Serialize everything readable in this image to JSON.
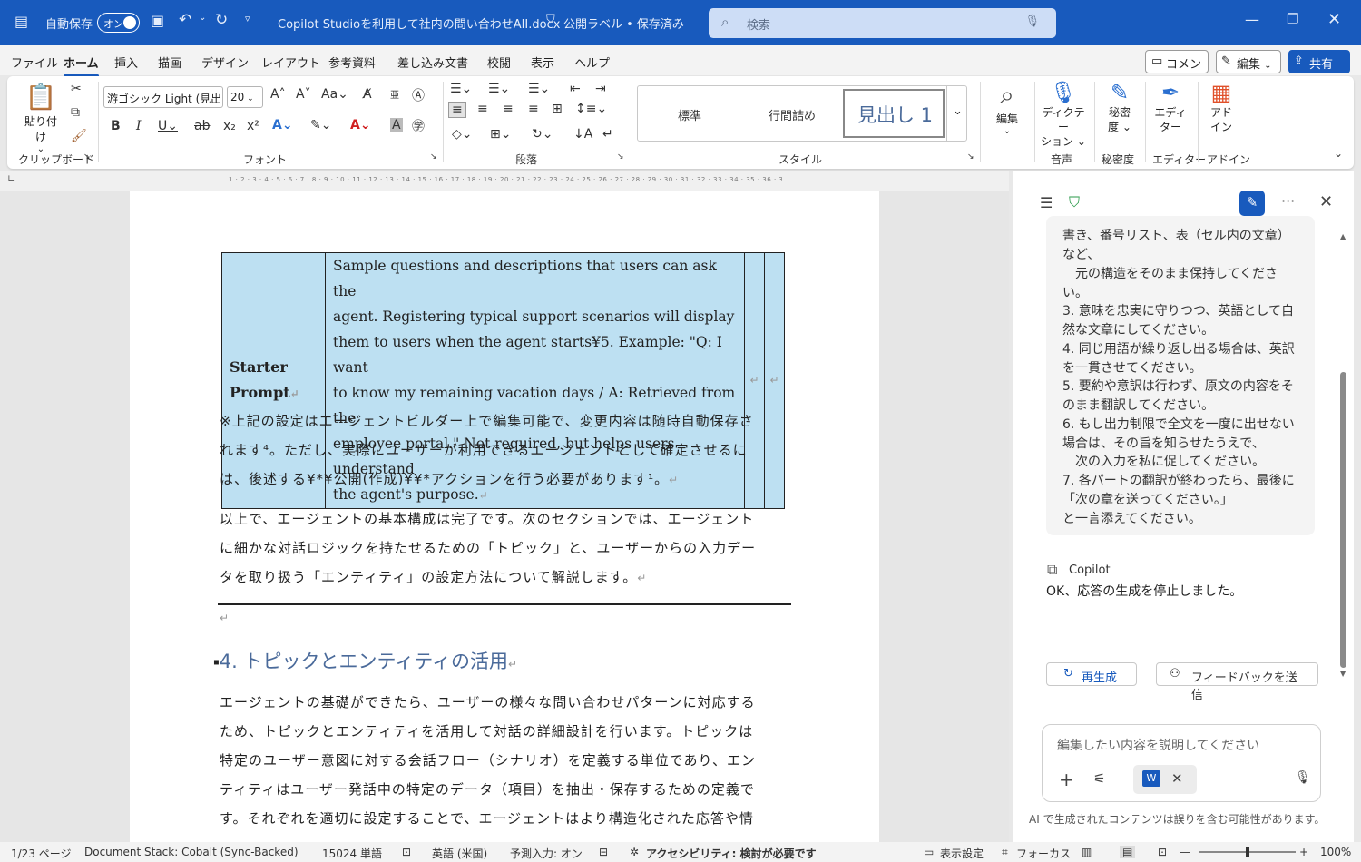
{
  "titlebar": {
    "autosave_label": "自動保存",
    "autosave_state": "オン",
    "doc_title": "Copilot Studioを利用して社内の問い合わせAII.docx",
    "label_status": "公開ラベル • 保存済み",
    "search_placeholder": "検索"
  },
  "menu": {
    "tabs": [
      "ファイル",
      "ホーム",
      "挿入",
      "描画",
      "デザイン",
      "レイアウト",
      "参考資料",
      "差し込み文書",
      "校閲",
      "表示",
      "ヘルプ"
    ],
    "active_tab": "ホーム",
    "comment_label": "コメント",
    "edit_label": "編集",
    "share_label": "共有"
  },
  "ribbon": {
    "paste_label": "貼り付け",
    "clipboard_group": "クリップボード",
    "font_name": "游ゴシック Light (見出し",
    "font_size": "20",
    "font_group": "フォント",
    "paragraph_group": "段落",
    "styles": [
      "標準",
      "行間詰め",
      "見出し 1"
    ],
    "styles_group": "スタイル",
    "edit_label": "編集",
    "dictation_label1": "ディクテー",
    "dictation_label2": "ション",
    "voice_group": "音声",
    "sensitivity_label1": "秘密",
    "sensitivity_label2": "度",
    "sensitivity_group": "秘密度",
    "editor_label1": "エディ",
    "editor_label2": "ター",
    "editor_group": "エディター",
    "addin_label1": "アド",
    "addin_label2": "イン",
    "addin_group": "アドイン"
  },
  "document": {
    "table": {
      "label_line1": "Starter",
      "label_line2": "Prompt",
      "desc_lines": [
        "Sample questions and descriptions that users can ask the",
        "agent. Registering typical support scenarios will display",
        "them to users when the agent starts¥5. Example: \"Q: I want",
        "to know my remaining vacation days / A: Retrieved from the",
        "employee portal.\" Not required, but helps users understand",
        "the agent's purpose."
      ]
    },
    "note_lines": [
      "※上記の設定はエージェントビルダー上で編集可能で、変更内容は随時自動保存さ",
      "れます⁴。ただし、実際にユーザーが利用できるエージェントとして確定させるに",
      "は、後述する¥*¥公開(作成)¥¥*アクションを行う必要があります¹。"
    ],
    "summary_lines": [
      "以上で、エージェントの基本構成は完了です。次のセクションでは、エージェント",
      "に細かな対話ロジックを持たせるための「トピック」と、ユーザーからの入力デー",
      "タを取り扱う「エンティティ」の設定方法について解説します。"
    ],
    "heading": "4. トピックとエンティティの活用",
    "body_lines": [
      "エージェントの基礎ができたら、ユーザーの様々な問い合わせパターンに対応する",
      "ため、トピックとエンティティを活用して対話の詳細設計を行います。トピックは",
      "特定のユーザー意図に対する会話フロー（シナリオ）を定義する単位であり、エン",
      "ティティはユーザー発話中の特定のデータ（項目）を抽出・保存するための定義で",
      "す。それぞれを適切に設定することで、エージェントはより構造化された応答や情"
    ]
  },
  "copilot": {
    "message_lines": [
      "書き、番号リスト、表（セル内の文章）",
      "など、",
      "　元の構造をそのまま保持してくださ",
      "い。",
      "3. 意味を忠実に守りつつ、英語として自",
      "然な文章にしてください。",
      "4. 同じ用語が繰り返し出る場合は、英訳",
      "を一貫させてください。",
      "5. 要約や意訳は行わず、原文の内容をそ",
      "のまま翻訳してください。",
      "6. もし出力制限で全文を一度に出せない",
      "場合は、その旨を知らせたうえで、",
      "　次の入力を私に促してください。",
      "7. 各パートの翻訳が終わったら、最後に",
      "「次の章を送ってください。」",
      "と一言添えてください。"
    ],
    "sender": "Copilot",
    "reply": "OK、応答の生成を停止しました。",
    "regenerate_label": "再生成",
    "feedback_label": "フィードバックを送信",
    "input_placeholder": "編集したい内容を説明してください",
    "disclaimer": "AI で生成されたコンテンツは誤りを含む可能性があります。"
  },
  "status": {
    "page": "1/23 ページ",
    "stack": "Document Stack: Cobalt (Sync-Backed)",
    "words": "15024 単語",
    "language": "英語 (米国)",
    "predict": "予測入力: オン",
    "accessibility": "アクセシビリティ: 検討が必要です",
    "display_settings": "表示設定",
    "focus": "フォーカス",
    "zoom": "100%"
  },
  "colors": {
    "brand": "#185abd",
    "table_fill": "#bde0f2",
    "heading": "#4a6a9a"
  }
}
